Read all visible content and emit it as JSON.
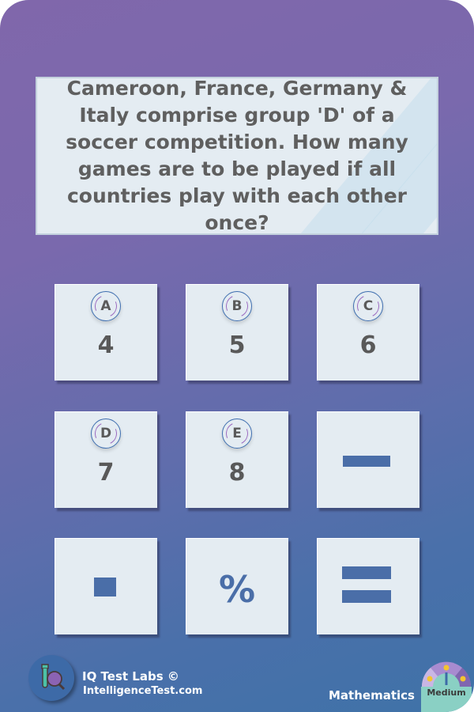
{
  "question": {
    "text": "Cameroon, France, Germany & Italy comprise group 'D' of a soccer competition. How many games are to be played if all countries play with each other once?"
  },
  "options": [
    {
      "letter": "A",
      "value": "4"
    },
    {
      "letter": "B",
      "value": "5"
    },
    {
      "letter": "C",
      "value": "6"
    },
    {
      "letter": "D",
      "value": "7"
    },
    {
      "letter": "E",
      "value": "8"
    }
  ],
  "keys": {
    "minus": "minus-icon",
    "dot": "square-dot-icon",
    "percent": "%",
    "equals": "equals-icon"
  },
  "footer": {
    "brand": "IQ Test Labs ©",
    "site": "IntelligenceTest.com",
    "category": "Mathematics",
    "difficulty": "Medium"
  },
  "colors": {
    "accent": "#4a6ea8",
    "card_top": "#8067ab",
    "card_bottom": "#3f72a8",
    "panel": "#e4ecf2",
    "text": "#5f5f5f"
  }
}
